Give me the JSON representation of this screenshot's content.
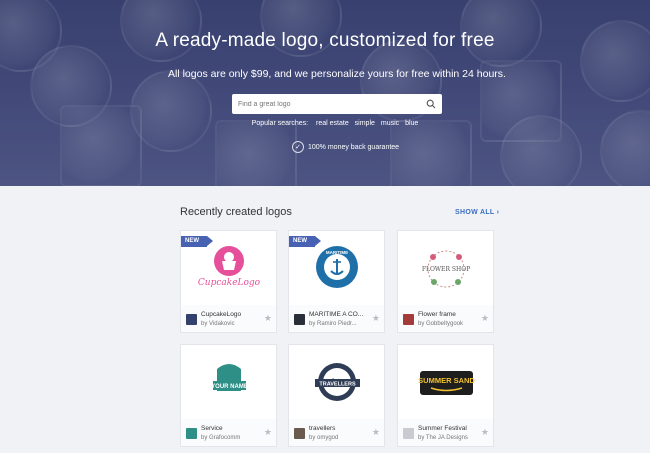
{
  "hero": {
    "title": "A ready-made logo, customized for free",
    "subtitle": "All logos are only $99, and we personalize yours for free within 24 hours.",
    "search_placeholder": "Find a great logo",
    "popular_label": "Popular searches:",
    "popular_terms": [
      "real estate",
      "simple",
      "music",
      "blue"
    ],
    "guarantee": "100% money back guarantee"
  },
  "section": {
    "title": "Recently created logos",
    "show_all": "SHOW ALL ›"
  },
  "cards": [
    {
      "name": "CupcakeLogo",
      "author": "by Vidakovic",
      "badge": "NEW",
      "logo_text": "CupcakeLogo",
      "avatar_color": "#34406e"
    },
    {
      "name": "MARITIME A CO...",
      "author": "by Ramiro Piedr...",
      "badge": "NEW",
      "logo_text": "MARITIME",
      "avatar_color": "#2a2f3a"
    },
    {
      "name": "Flower frame",
      "author": "by Gobbeltygook",
      "badge": "",
      "logo_text": "FLOWER SHOP",
      "avatar_color": "#a33b3b"
    },
    {
      "name": "Service",
      "author": "by Grafocomm",
      "badge": "",
      "logo_text": "YOUR NAME",
      "avatar_color": "#2d8f86"
    },
    {
      "name": "travellers",
      "author": "by omygod",
      "badge": "",
      "logo_text": "TRAVELLERS",
      "avatar_color": "#6b5b4e"
    },
    {
      "name": "Summer Festival",
      "author": "by The JA Designs",
      "badge": "",
      "logo_text": "SUMMER SAND",
      "avatar_color": "#c9cbd0"
    }
  ],
  "colors": {
    "accent": "#3b6fc3",
    "badge": "#4762b2",
    "hero_bg": "#4a5386"
  },
  "icons": [
    "search-icon",
    "check-circle-icon",
    "star-icon",
    "chevron-right-icon"
  ]
}
